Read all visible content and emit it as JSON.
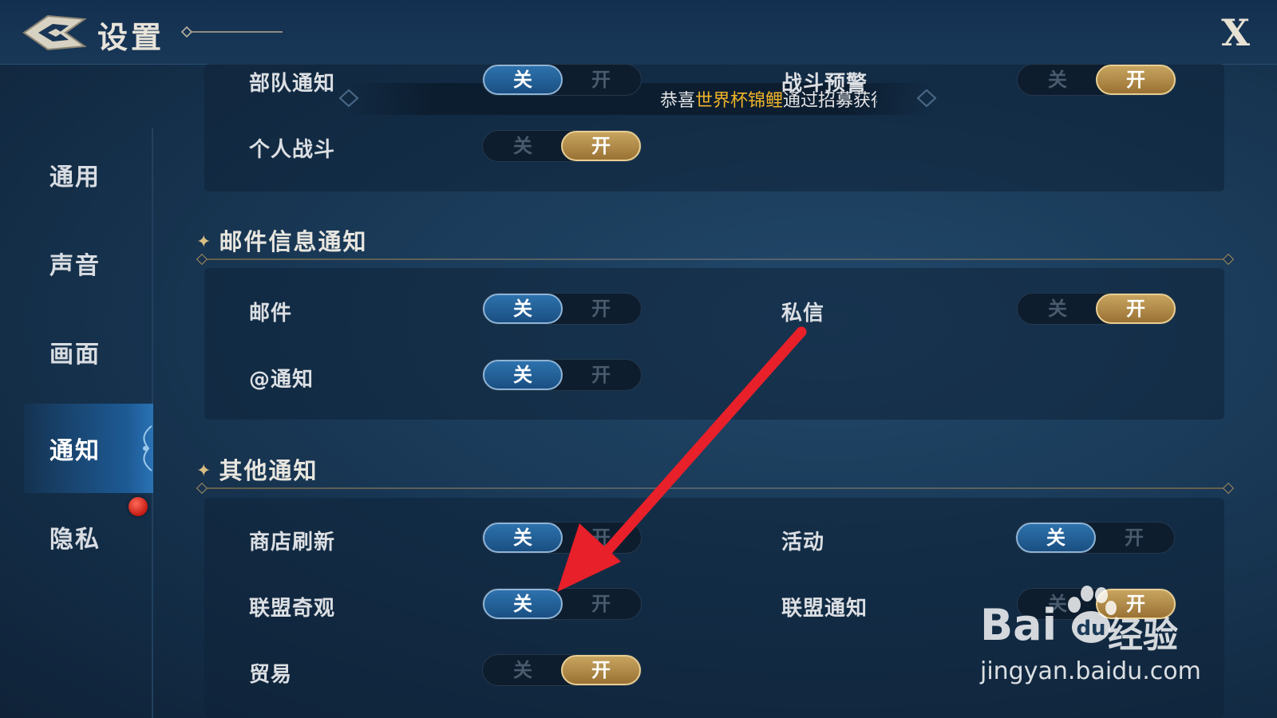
{
  "header": {
    "title": "设置",
    "close_label": "X"
  },
  "sidebar": {
    "items": [
      {
        "label": "通用"
      },
      {
        "label": "声音"
      },
      {
        "label": "画面"
      },
      {
        "label": "通知",
        "active": true
      },
      {
        "label": "隐私",
        "badge": "red-dot"
      }
    ]
  },
  "banner": {
    "prefix": "恭喜",
    "highlight": "世界杯锦鲤",
    "suffix": "通过招募获得"
  },
  "toggle_labels": {
    "off": "关",
    "on": "开"
  },
  "sections": [
    {
      "title": "",
      "rows": [
        {
          "label": "部队通知",
          "state": "off"
        },
        {
          "label": "战斗预警",
          "state": "on"
        },
        {
          "label": "个人战斗",
          "state": "on"
        }
      ]
    },
    {
      "title": "邮件信息通知",
      "rows": [
        {
          "label": "邮件",
          "state": "off"
        },
        {
          "label": "私信",
          "state": "on"
        },
        {
          "label": "@通知",
          "state": "off"
        }
      ]
    },
    {
      "title": "其他通知",
      "rows": [
        {
          "label": "商店刷新",
          "state": "off"
        },
        {
          "label": "活动",
          "state": "off"
        },
        {
          "label": "联盟奇观",
          "state": "off"
        },
        {
          "label": "联盟通知",
          "state": "on"
        },
        {
          "label": "贸易",
          "state": "on"
        }
      ]
    }
  ],
  "colors": {
    "toggle_off_active": "#2d72ad",
    "toggle_on_active": "#c7a45f",
    "annotation_arrow": "#e8202a",
    "banner_highlight": "#f0b429"
  },
  "watermark": {
    "brand": "Bai",
    "brand_cn": "经验",
    "url": "jingyan.baidu.com"
  }
}
